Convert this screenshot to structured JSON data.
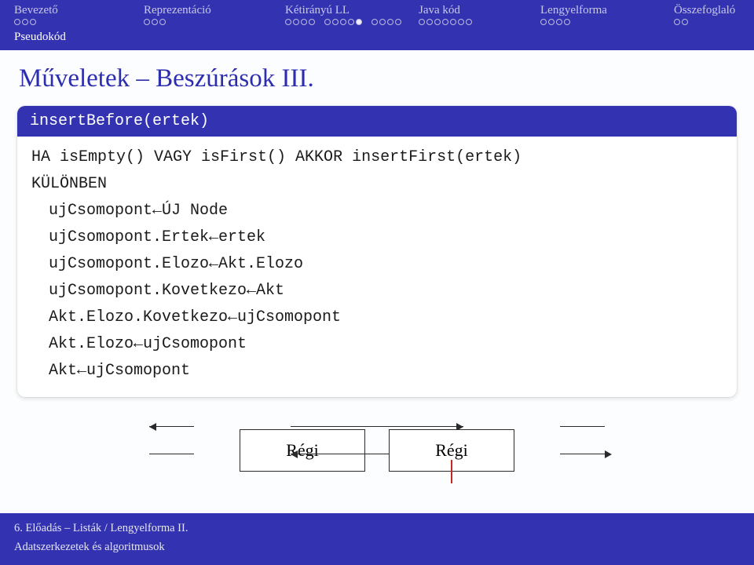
{
  "nav": {
    "sections": [
      {
        "label": "Bevezető",
        "dots": [
          0,
          0,
          0
        ],
        "current": -1
      },
      {
        "label": "Reprezentáció",
        "dots": [
          0,
          0,
          0
        ],
        "current": -1
      },
      {
        "label": "Kétirányú LL",
        "dots": [
          0,
          0,
          0,
          0,
          0,
          0,
          0,
          0,
          1,
          0,
          0,
          0,
          0
        ],
        "current": 8
      },
      {
        "label": "Java kód",
        "dots": [
          0,
          0,
          0,
          0,
          0,
          0,
          0
        ],
        "current": -1
      },
      {
        "label": "Lengyelforma",
        "dots": [
          0,
          0,
          0,
          0
        ],
        "current": -1
      },
      {
        "label": "Összefoglaló",
        "dots": [
          0,
          0
        ],
        "current": -1
      }
    ],
    "sub": "Pseudokód"
  },
  "title": "Műveletek – Beszúrások III.",
  "block": {
    "head": "insertBefore(ertek)",
    "lines": [
      "HA isEmpty() VAGY isFirst() AKKOR insertFirst(ertek)",
      "KÜLÖNBEN",
      " ujCsomopont←ÚJ Node",
      " ujCsomopont.Ertek←ertek",
      " ujCsomopont.Elozo←Akt.Elozo",
      " ujCsomopont.Kovetkezo←Akt",
      " Akt.Elozo.Kovetkezo←ujCsomopont",
      " Akt.Elozo←ujCsomopont",
      " Akt←ujCsomopont"
    ]
  },
  "diagram": {
    "node1": "Régi",
    "node2": "Régi"
  },
  "footer": {
    "line1": "6. Előadás – Listák / Lengyelforma II.",
    "line2": "Adatszerkezetek és algoritmusok"
  }
}
